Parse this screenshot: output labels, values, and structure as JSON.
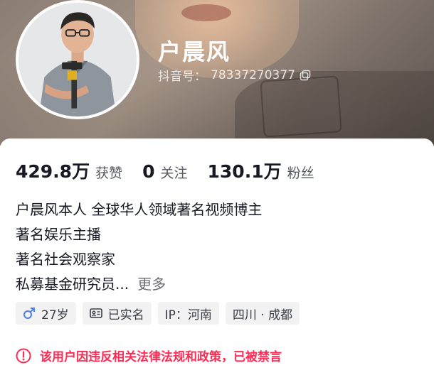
{
  "profile": {
    "username": "户晨风",
    "douyin_id_label": "抖音号：",
    "douyin_id": "78337270377"
  },
  "stats": [
    {
      "value": "429.8万",
      "label": "获赞"
    },
    {
      "value": "0",
      "label": "关注"
    },
    {
      "value": "130.1万",
      "label": "粉丝"
    }
  ],
  "bio": {
    "lines": [
      "户晨风本人  全球华人领域著名视频博主",
      "著名娱乐主播",
      "著名社会观察家",
      "私募基金研究员..."
    ],
    "more_label": "更多"
  },
  "tags": {
    "age": "27岁",
    "verified": "已实名",
    "ip": "IP：河南",
    "location": "四川 · 成都"
  },
  "ban_notice": "该用户因违反相关法律法规和政策，已被禁言",
  "colors": {
    "ban_red": "#fe2c55",
    "male_blue": "#4d7cf5",
    "tag_bg": "#f2f2f3"
  },
  "icons": {
    "copy": "copy-icon",
    "male": "male-icon",
    "id_card": "id-card-icon",
    "warning": "warning-circle-icon"
  }
}
